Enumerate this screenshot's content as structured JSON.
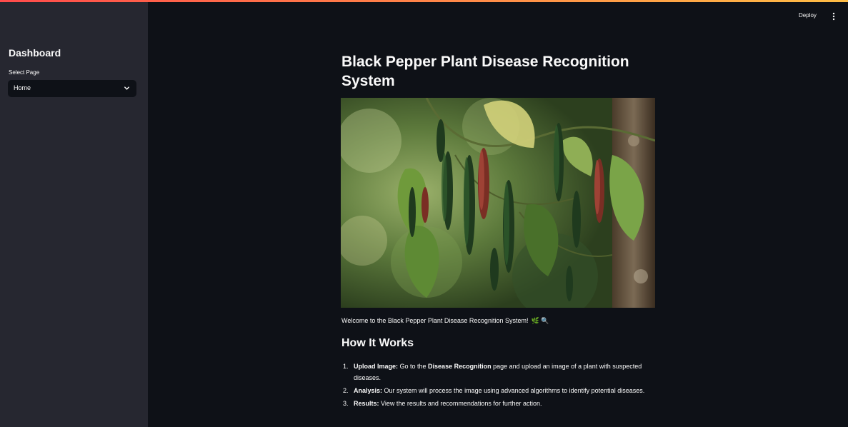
{
  "header": {
    "deploy_label": "Deploy",
    "menu_icon": "kebab-menu-icon"
  },
  "sidebar": {
    "title": "Dashboard",
    "select_label": "Select Page",
    "select_value": "Home",
    "select_icon": "chevron-down-icon"
  },
  "main": {
    "title": "Black Pepper Plant Disease Recognition System",
    "image_alt": "black pepper plant with green and red berry clusters",
    "welcome": "Welcome to the Black Pepper Plant Disease Recognition System!",
    "welcome_emoji": "🌿 🔍",
    "how_heading": "How It Works",
    "steps": [
      {
        "num": "1.",
        "bold": "Upload Image:",
        "t1": " Go to the ",
        "bold2": "Disease Recognition",
        "t2": " page and upload an image of a plant with suspected diseases."
      },
      {
        "num": "2.",
        "bold": "Analysis:",
        "t1": " Our system will process the image using advanced algorithms to identify potential diseases."
      },
      {
        "num": "3.",
        "bold": "Results:",
        "t1": " View the results and recommendations for further action."
      }
    ]
  },
  "colors": {
    "background": "#0e1117",
    "sidebar": "#262730",
    "text": "#fafafa",
    "accent": "#ff4b4b"
  }
}
